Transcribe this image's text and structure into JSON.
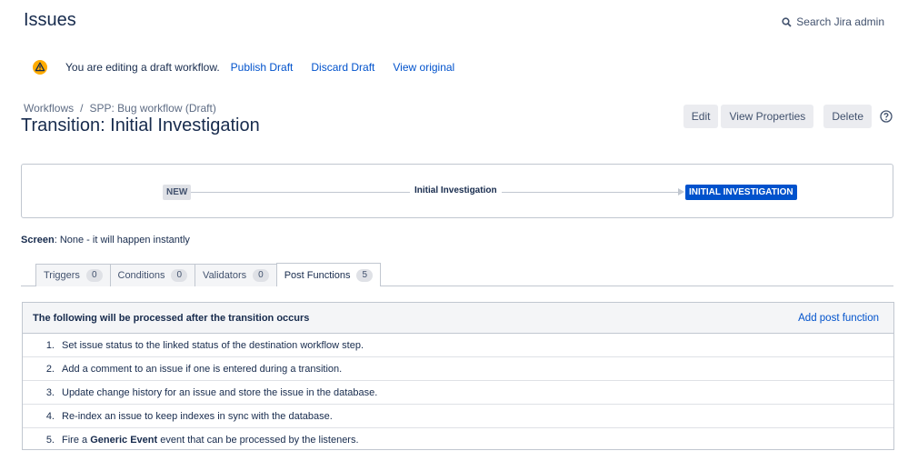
{
  "header": {
    "title": "Issues",
    "search_label": "Search Jira admin"
  },
  "draft_notice": {
    "message": "You are editing a draft workflow.",
    "publish": "Publish Draft",
    "discard": "Discard Draft",
    "view_original": "View original"
  },
  "breadcrumb": {
    "root": "Workflows",
    "separator": "/",
    "workflow": "SPP: Bug workflow (Draft)"
  },
  "page_title": "Transition: Initial Investigation",
  "actions": {
    "edit": "Edit",
    "view_properties": "View Properties",
    "delete": "Delete"
  },
  "diagram": {
    "from_status": "NEW",
    "transition": "Initial Investigation",
    "to_status": "INITIAL INVESTIGATION"
  },
  "screen": {
    "label": "Screen",
    "value": ": None - it will happen instantly"
  },
  "tabs": [
    {
      "label": "Triggers",
      "count": "0"
    },
    {
      "label": "Conditions",
      "count": "0"
    },
    {
      "label": "Validators",
      "count": "0"
    },
    {
      "label": "Post Functions",
      "count": "5",
      "active": true
    }
  ],
  "post_functions": {
    "heading": "The following will be processed after the transition occurs",
    "add_label": "Add post function",
    "items": [
      {
        "num": "1.",
        "text": "Set issue status to the linked status of the destination workflow step."
      },
      {
        "num": "2.",
        "text": "Add a comment to an issue if one is entered during a transition."
      },
      {
        "num": "3.",
        "text": "Update change history for an issue and store the issue in the database."
      },
      {
        "num": "4.",
        "text": "Re-index an issue to keep indexes in sync with the database."
      },
      {
        "num": "5.",
        "pre": "Fire a ",
        "bold": "Generic Event",
        "post": " event that can be processed by the listeners."
      }
    ]
  },
  "colors": {
    "link": "#0052cc",
    "target_status": "#0052cc",
    "warning": "#ffab00"
  }
}
